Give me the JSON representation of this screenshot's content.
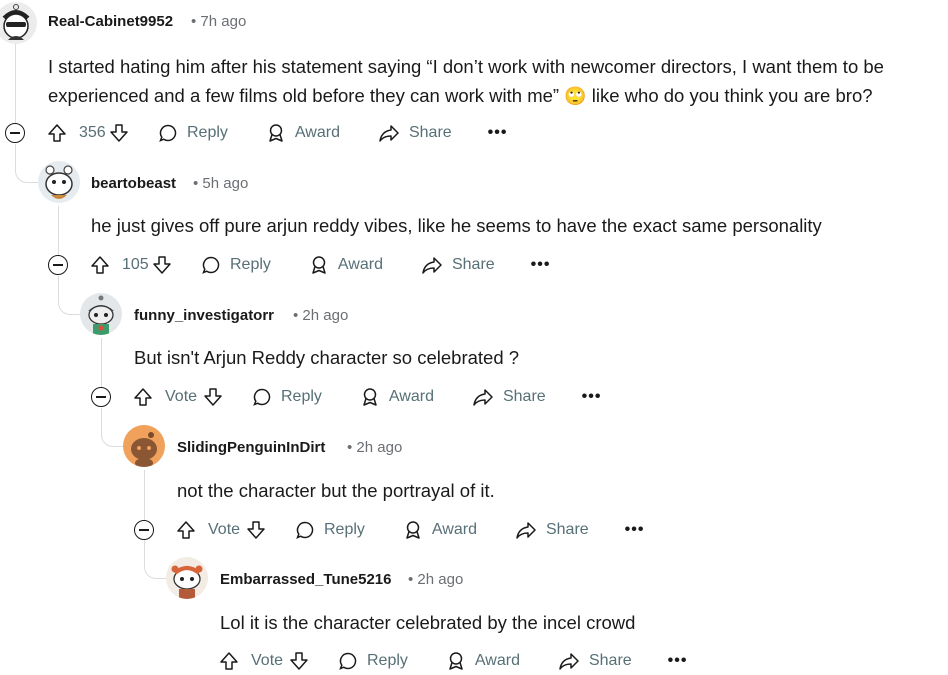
{
  "comments": [
    {
      "username": "Real-Cabinet9952",
      "time": "• 7h ago",
      "text_line1": "I started hating him after his statement saying “I don’t work with newcomer directors, I want them to be",
      "text_line2": "experienced and a few films old before they can work with me”",
      "emoji": "🙄",
      "text_line2_tail": "like who do you think you are bro?",
      "votes": "356",
      "avatar_color": "#e8e8e8"
    },
    {
      "username": "beartobeast",
      "time": "• 5h ago",
      "text": "he just gives off pure arjun reddy vibes, like he seems to have the exact same personality",
      "votes": "105",
      "avatar_color": "#dfe6ee"
    },
    {
      "username": "funny_investigatorr",
      "time": "• 2h ago",
      "text": "But isn't Arjun Reddy character so celebrated ?",
      "votes": "Vote",
      "avatar_color": "#e4e7ea"
    },
    {
      "username": "SlidingPenguinInDirt",
      "time": "• 2h ago",
      "text": "not the character but the portrayal of it.",
      "votes": "Vote",
      "avatar_color": "#f0a15c"
    },
    {
      "username": "Embarrassed_Tune5216",
      "time": "• 2h ago",
      "text": "Lol it is the character celebrated by the incel crowd",
      "votes": "Vote",
      "avatar_color": "#f3ece4"
    }
  ],
  "actions": {
    "reply": "Reply",
    "award": "Award",
    "share": "Share",
    "more": "•••"
  },
  "icons": {
    "upvote": "upvote-arrow-icon",
    "downvote": "downvote-arrow-icon",
    "reply": "speech-bubble-icon",
    "award": "award-ribbon-icon",
    "share": "share-arrow-icon",
    "collapse": "collapse-minus-icon"
  }
}
